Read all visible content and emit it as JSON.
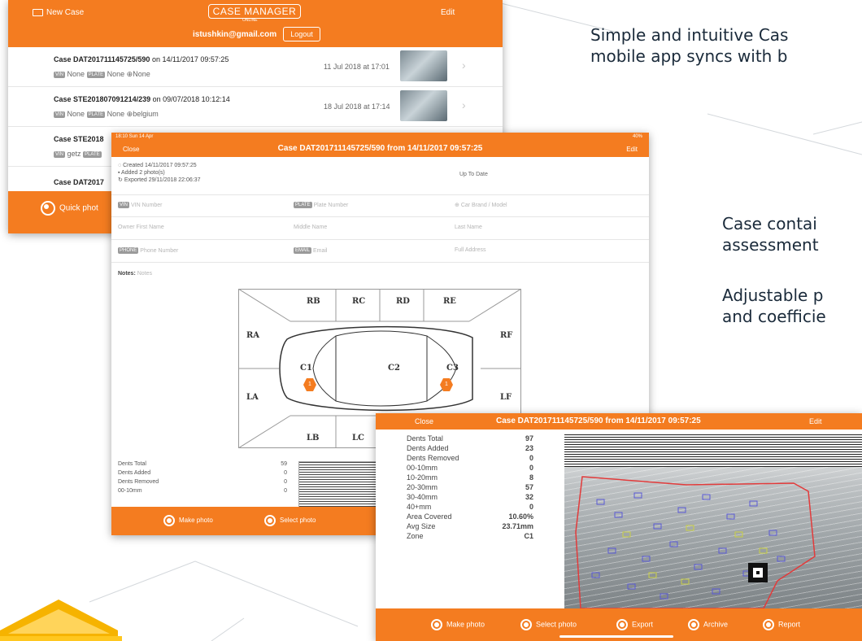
{
  "marketing": {
    "line1": "Simple and intuitive Cas",
    "line2": "mobile app syncs with b",
    "line3": "Case contai",
    "line4": "assessment",
    "line5": "Adjustable p",
    "line6": "and coefficie"
  },
  "case_list": {
    "new_case": "New Case",
    "logo": "CASE MANAGER",
    "logo_sub": "ONLINE",
    "edit": "Edit",
    "user_email": "istushkin@gmail.com",
    "logout": "Logout",
    "quick_photo": "Quick phot",
    "items": [
      {
        "name": "Case DAT201711145725/590",
        "created": "on 14/11/2017 09:57:25",
        "date": "11 Jul 2018 at 17:01",
        "vin_tag": "VIN",
        "vin": "None",
        "plate_tag": "PLATE",
        "plate": "None",
        "brand": "None"
      },
      {
        "name": "Case STE201807091214/239",
        "created": "on 09/07/2018 10:12:14",
        "date": "18 Jul 2018 at 17:14",
        "vin_tag": "VIN",
        "vin": "None",
        "plate_tag": "PLATE",
        "plate": "None",
        "brand": "belgium"
      },
      {
        "name": "Case STE2018",
        "vin_tag": "VIN",
        "vin": "getz",
        "plate_tag": "PLATE"
      },
      {
        "name": "Case DAT2017"
      }
    ]
  },
  "case_detail": {
    "status_time": "18:10  Sun 14 Apr",
    "status_right": "40%",
    "close": "Close",
    "title": "Case DAT201711145725/590 from 14/11/2017 09:57:25",
    "edit": "Edit",
    "created": "Created 14/11/2017 09:57:25",
    "added": "Added 2 photo(s)",
    "exported": "Exported 29/11/2018 22:06:37",
    "up_to_date": "Up To Date",
    "vin_tag": "VIN",
    "vin_ph": "VIN Number",
    "plate_tag": "PLATE",
    "plate_ph": "Plate Number",
    "brand_ph": "Car Brand / Model",
    "first_name": "Owner First Name",
    "middle_name": "Middle Name",
    "last_name": "Last Name",
    "phone_tag": "PHONE",
    "phone_ph": "Phone Number",
    "email_tag": "EMAIL",
    "email_ph": "Email",
    "address_ph": "Full Address",
    "notes_label": "Notes:",
    "notes_ph": "Notes",
    "zones": {
      "RB": "RB",
      "RC": "RC",
      "RD": "RD",
      "RE": "RE",
      "RA": "RA",
      "RF": "RF",
      "C1": "C1",
      "C2": "C2",
      "C3": "C3",
      "LA": "LA",
      "LF": "LF",
      "LB": "LB",
      "LC": "LC"
    },
    "marker1": "1",
    "marker2": "1",
    "stats": [
      {
        "label": "Dents Total",
        "value": "59"
      },
      {
        "label": "Dents Added",
        "value": "0"
      },
      {
        "label": "Dents Removed",
        "value": "0"
      },
      {
        "label": "00-10mm",
        "value": "0"
      }
    ],
    "make_photo": "Make photo",
    "select_photo": "Select photo"
  },
  "dent_report": {
    "close": "Close",
    "title": "Case DAT201711145725/590 from 14/11/2017 09:57:25",
    "edit": "Edit",
    "stats": [
      {
        "label": "Dents Total",
        "value": "97"
      },
      {
        "label": "Dents Added",
        "value": "23"
      },
      {
        "label": "Dents Removed",
        "value": "0"
      },
      {
        "label": "00-10mm",
        "value": "0"
      },
      {
        "label": "10-20mm",
        "value": "8"
      },
      {
        "label": "20-30mm",
        "value": "57"
      },
      {
        "label": "30-40mm",
        "value": "32"
      },
      {
        "label": "40+mm",
        "value": "0"
      },
      {
        "label": "Area Covered",
        "value": "10.60%"
      },
      {
        "label": "Avg Size",
        "value": "23.71mm"
      },
      {
        "label": "Zone",
        "value": "C1"
      }
    ],
    "buttons": [
      "Make photo",
      "Select photo",
      "Export",
      "Archive",
      "Report"
    ]
  },
  "colors": {
    "accent": "#f47c20",
    "brand_yellow": "#f6b300"
  }
}
